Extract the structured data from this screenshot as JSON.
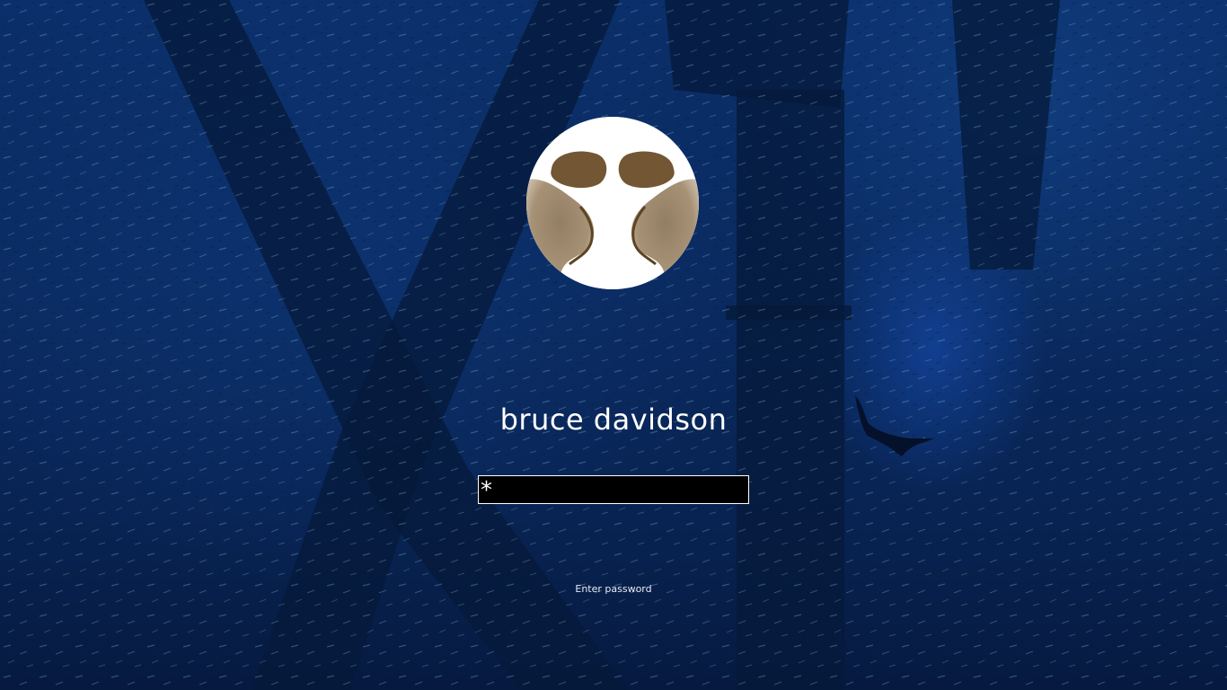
{
  "lockscreen": {
    "username": "bruce davidson",
    "password_masked": "*",
    "hint": "Enter password"
  },
  "colors": {
    "background_deep_blue": "#0a2a60",
    "text": "#ffffff",
    "input_background": "#000000",
    "input_border": "#ffffff"
  },
  "icons": {
    "avatar": "user-avatar-inkblot"
  }
}
